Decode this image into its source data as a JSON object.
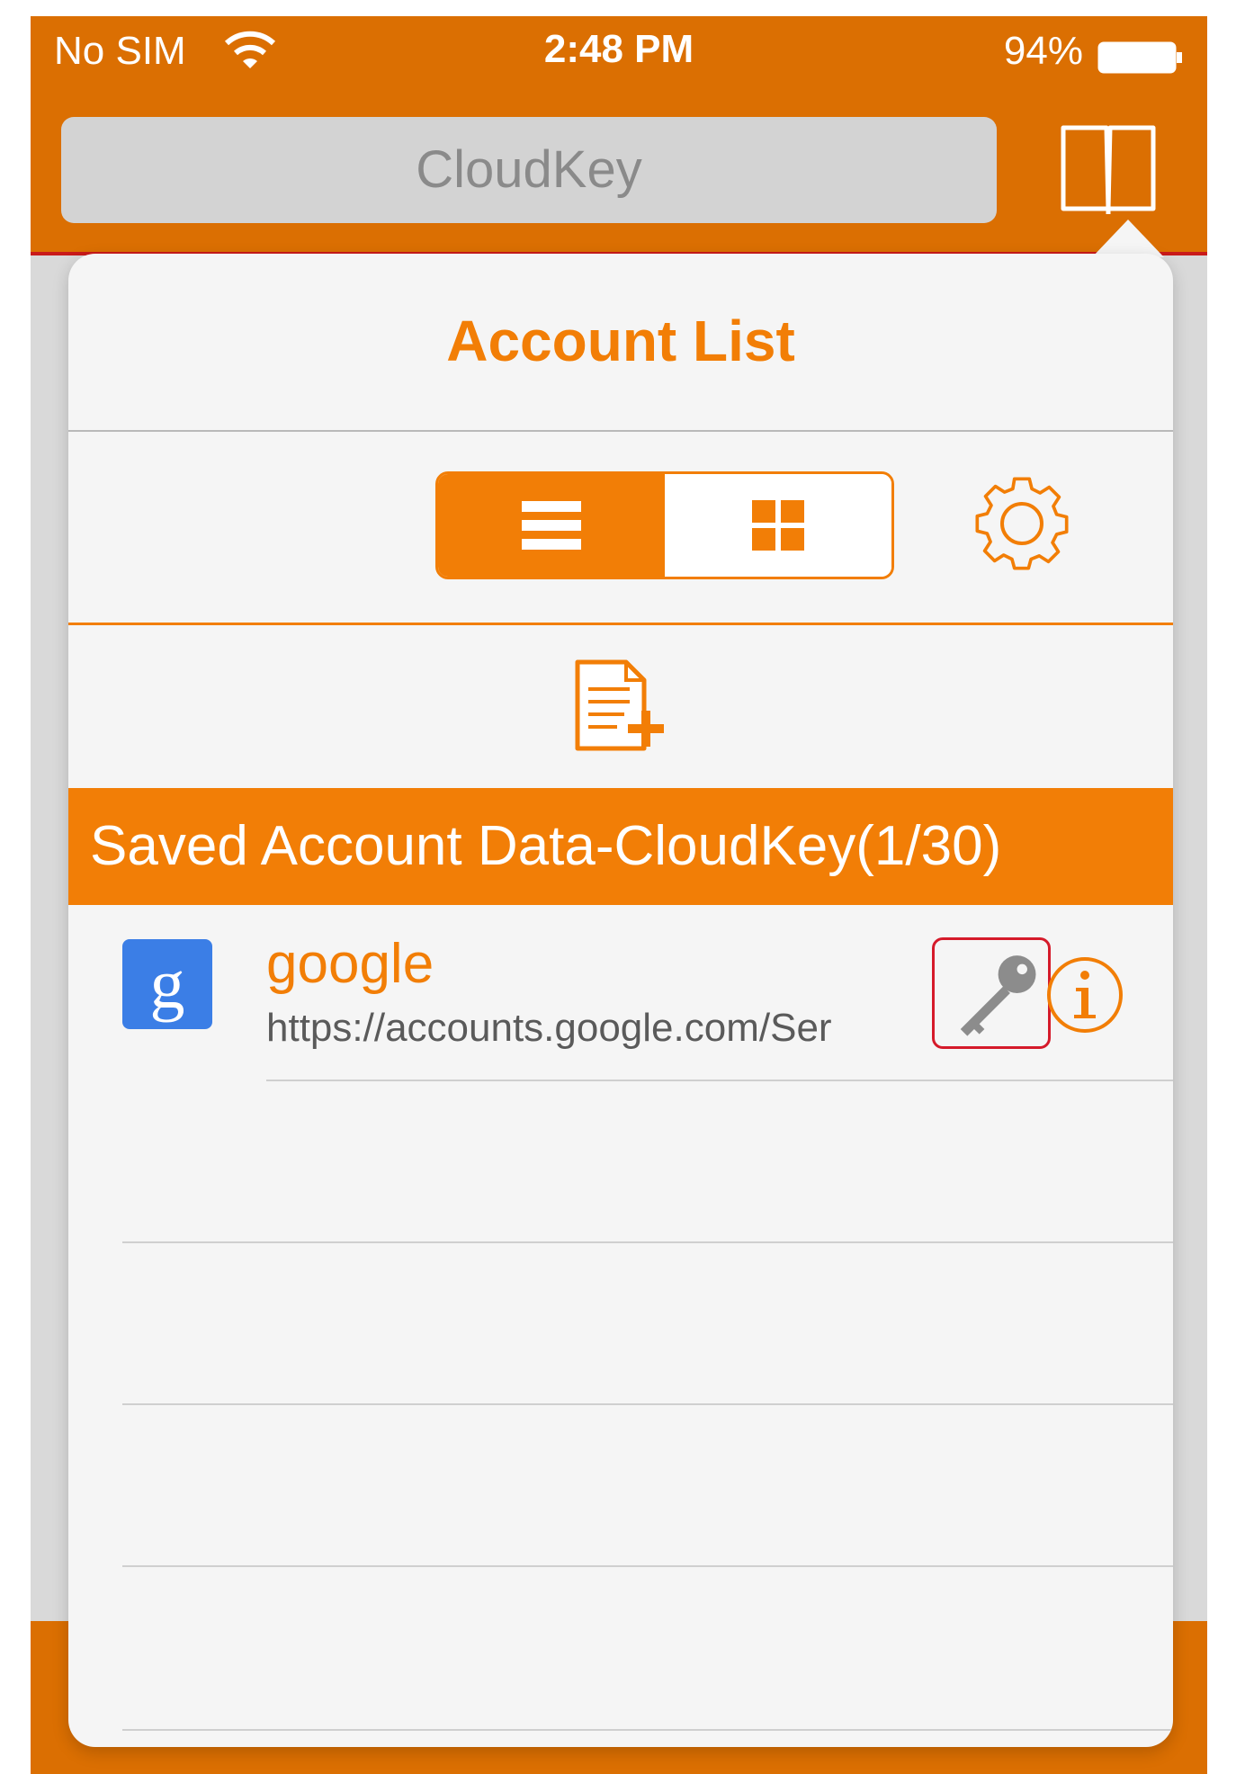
{
  "status_bar": {
    "carrier": "No SIM",
    "time": "2:48 PM",
    "battery": "94%"
  },
  "nav": {
    "address": "CloudKey",
    "bookmarks_icon": "book-icon"
  },
  "popover": {
    "title": "Account List",
    "view_mode": "list",
    "view_options": [
      "list",
      "grid"
    ],
    "settings_icon": "gear-icon",
    "add_icon": "add-document-icon",
    "section_header": "Saved Account Data-CloudKey(1/30)",
    "accounts": [
      {
        "name": "google",
        "url": "https://accounts.google.com/Ser",
        "icon": "google-icon",
        "icon_letter": "g"
      }
    ]
  },
  "colors": {
    "brand_orange": "#db6f02",
    "accent_orange": "#f27e06",
    "highlight_red": "#d51a2a"
  }
}
